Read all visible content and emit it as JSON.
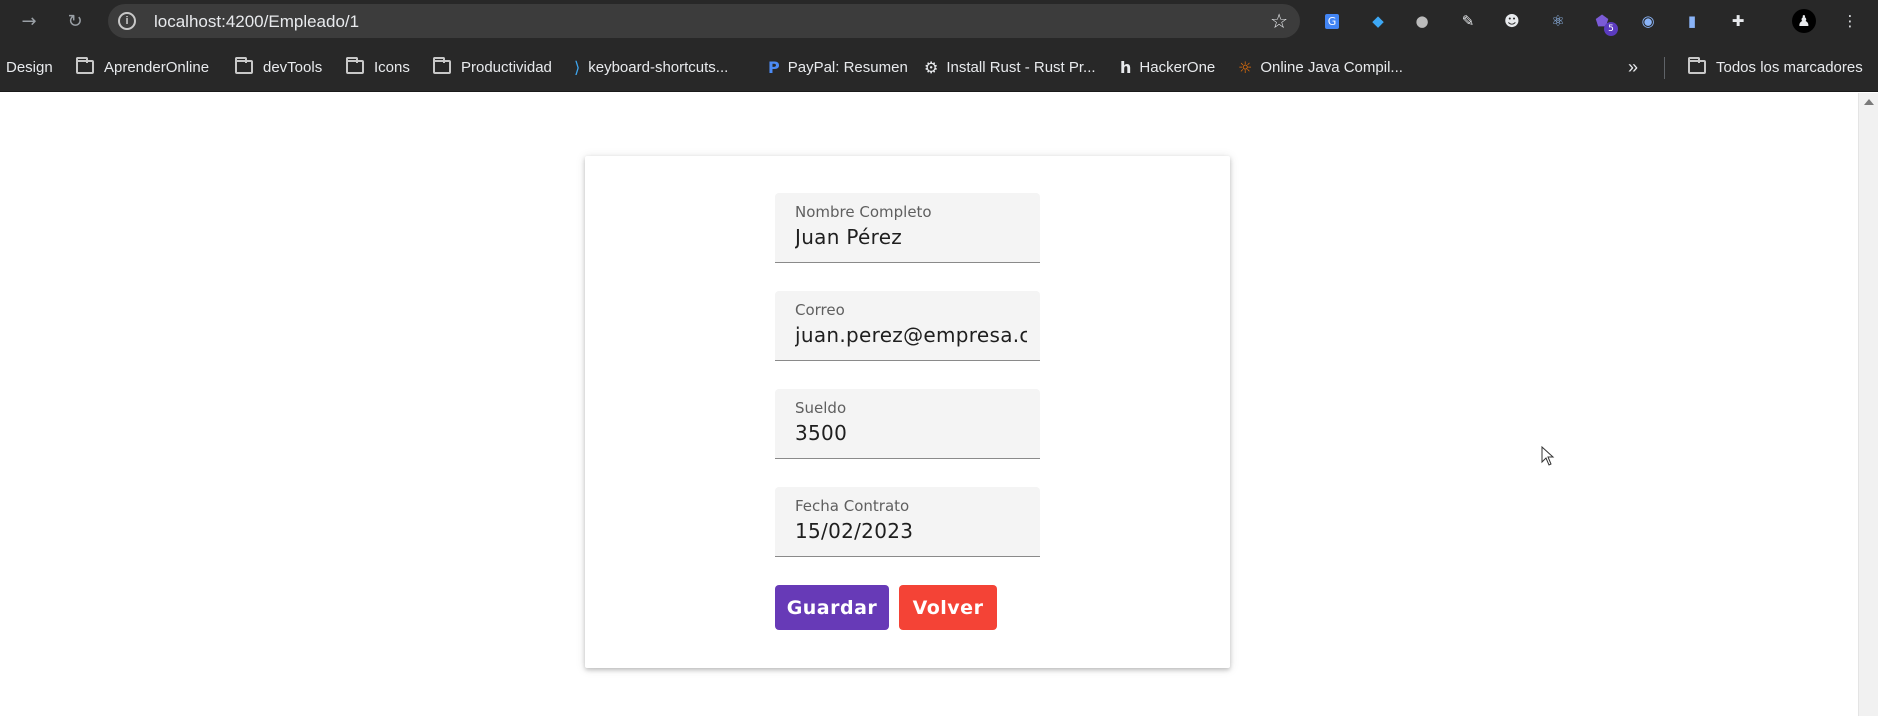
{
  "browser": {
    "url": "localhost:4200/Empleado/1",
    "back_icon": "arrow-left-icon",
    "reload_icon": "reload-icon",
    "extension_badge": "5"
  },
  "bookmarks": {
    "items": [
      {
        "label": "Design",
        "icon": "none"
      },
      {
        "label": "AprenderOnline",
        "icon": "folder-icon"
      },
      {
        "label": "devTools",
        "icon": "folder-icon"
      },
      {
        "label": "Icons",
        "icon": "folder-icon"
      },
      {
        "label": "Productividad",
        "icon": "folder-icon"
      },
      {
        "label": "keyboard-shortcuts...",
        "icon": "vscode-icon"
      },
      {
        "label": "PayPal: Resumen",
        "icon": "paypal-icon"
      },
      {
        "label": "Install Rust - Rust Pr...",
        "icon": "rust-icon"
      },
      {
        "label": "HackerOne",
        "icon": "hackerone-icon"
      },
      {
        "label": "Online Java Compil...",
        "icon": "java-compiler-icon"
      }
    ],
    "overflow": "»",
    "all_bookmarks": "Todos los marcadores"
  },
  "form": {
    "nombre": {
      "label": "Nombre Completo",
      "value": "Juan Pérez"
    },
    "correo": {
      "label": "Correo",
      "value": "juan.perez@empresa.com"
    },
    "sueldo": {
      "label": "Sueldo",
      "value": "3500"
    },
    "fecha": {
      "label": "Fecha Contrato",
      "value": "15/02/2023"
    },
    "save_label": "Guardar",
    "back_label": "Volver"
  },
  "colors": {
    "save": "#673ab7",
    "back": "#f44336"
  }
}
